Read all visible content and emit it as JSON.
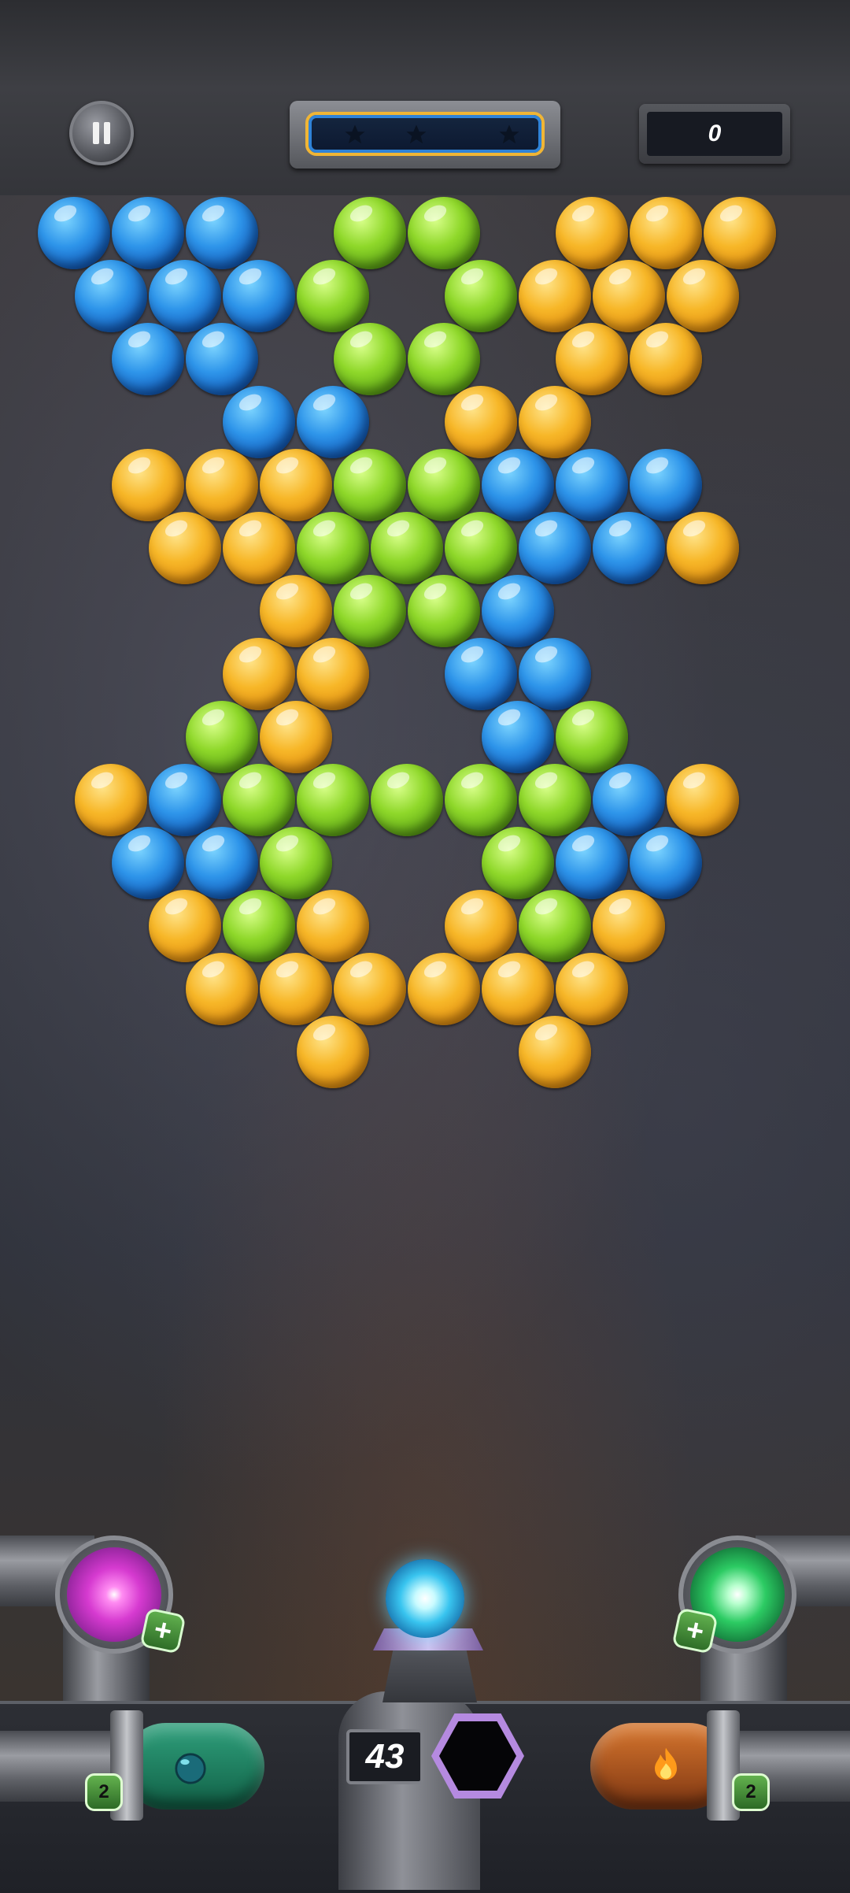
{
  "header": {
    "score": "0",
    "stars_total": 3,
    "progress_fraction": 0.0
  },
  "bubbles": [
    [
      {
        "c": "blue"
      },
      {
        "c": "blue"
      },
      {
        "c": "blue"
      },
      null,
      {
        "c": "green"
      },
      {
        "c": "green"
      },
      null,
      {
        "c": "yellow"
      },
      {
        "c": "yellow"
      },
      {
        "c": "yellow"
      }
    ],
    [
      {
        "c": "blue"
      },
      {
        "c": "blue"
      },
      {
        "c": "blue"
      },
      {
        "c": "green"
      },
      null,
      {
        "c": "green"
      },
      {
        "c": "yellow"
      },
      {
        "c": "yellow"
      },
      {
        "c": "yellow"
      },
      null
    ],
    [
      null,
      {
        "c": "blue"
      },
      {
        "c": "blue"
      },
      null,
      {
        "c": "green"
      },
      {
        "c": "green"
      },
      null,
      {
        "c": "yellow"
      },
      {
        "c": "yellow"
      },
      null
    ],
    [
      null,
      null,
      {
        "c": "blue"
      },
      {
        "c": "blue"
      },
      null,
      {
        "c": "yellow"
      },
      {
        "c": "yellow"
      },
      null,
      null,
      null
    ],
    [
      null,
      {
        "c": "yellow"
      },
      {
        "c": "yellow"
      },
      {
        "c": "yellow"
      },
      {
        "c": "green"
      },
      {
        "c": "green"
      },
      {
        "c": "blue"
      },
      {
        "c": "blue"
      },
      {
        "c": "blue"
      },
      null
    ],
    [
      null,
      {
        "c": "yellow"
      },
      {
        "c": "yellow"
      },
      {
        "c": "green"
      },
      {
        "c": "green"
      },
      {
        "c": "green"
      },
      {
        "c": "blue"
      },
      {
        "c": "blue"
      },
      {
        "c": "yellow"
      },
      null
    ],
    [
      null,
      null,
      null,
      {
        "c": "yellow"
      },
      {
        "c": "green"
      },
      {
        "c": "green"
      },
      {
        "c": "blue"
      },
      null,
      null,
      null
    ],
    [
      null,
      null,
      {
        "c": "yellow"
      },
      {
        "c": "yellow"
      },
      null,
      {
        "c": "blue"
      },
      {
        "c": "blue"
      },
      null,
      null,
      null
    ],
    [
      null,
      null,
      {
        "c": "green"
      },
      {
        "c": "yellow"
      },
      null,
      null,
      {
        "c": "blue"
      },
      {
        "c": "green"
      },
      null,
      null
    ],
    [
      {
        "c": "yellow"
      },
      {
        "c": "blue"
      },
      {
        "c": "green"
      },
      {
        "c": "green"
      },
      {
        "c": "green"
      },
      {
        "c": "green"
      },
      {
        "c": "green"
      },
      {
        "c": "blue"
      },
      {
        "c": "yellow"
      },
      null
    ],
    [
      null,
      {
        "c": "blue"
      },
      {
        "c": "blue"
      },
      {
        "c": "green"
      },
      null,
      null,
      {
        "c": "green"
      },
      {
        "c": "blue"
      },
      {
        "c": "blue"
      },
      null
    ],
    [
      null,
      {
        "c": "yellow"
      },
      {
        "c": "green"
      },
      {
        "c": "yellow"
      },
      null,
      {
        "c": "yellow"
      },
      {
        "c": "green"
      },
      {
        "c": "yellow"
      },
      null,
      null
    ],
    [
      null,
      null,
      {
        "c": "yellow"
      },
      {
        "c": "yellow"
      },
      {
        "c": "yellow"
      },
      {
        "c": "yellow"
      },
      {
        "c": "yellow"
      },
      {
        "c": "yellow"
      },
      null,
      null
    ],
    [
      null,
      null,
      null,
      {
        "c": "yellow"
      },
      null,
      null,
      {
        "c": "yellow"
      },
      null,
      null,
      null
    ]
  ],
  "boosters": {
    "magenta_plus": "+",
    "green_plus": "+",
    "left_count": "2",
    "right_count": "2"
  },
  "launcher": {
    "shots_left": "43",
    "current_bubble": "cyan-energy"
  }
}
